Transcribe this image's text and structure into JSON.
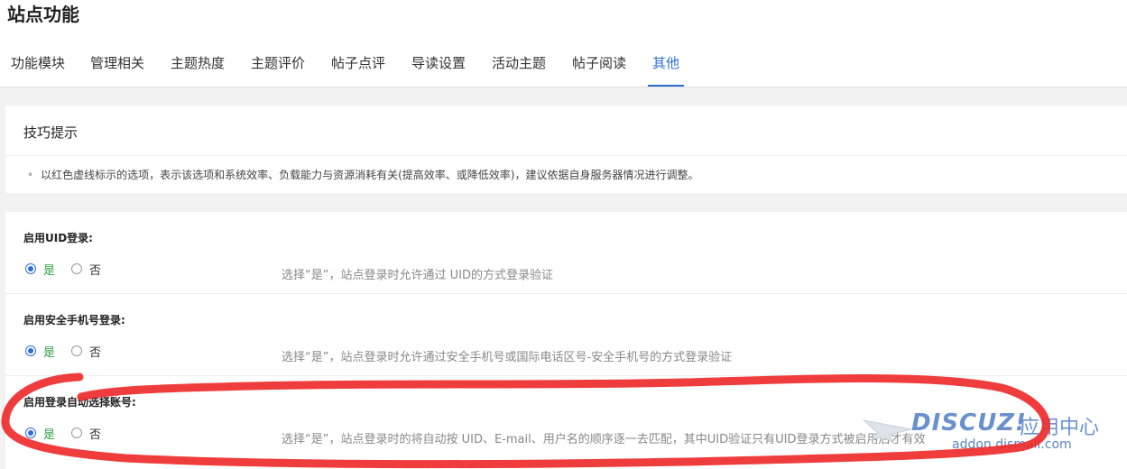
{
  "page": {
    "title": "站点功能"
  },
  "tabs": [
    {
      "label": "功能模块"
    },
    {
      "label": "管理相关"
    },
    {
      "label": "主题热度"
    },
    {
      "label": "主题评价"
    },
    {
      "label": "帖子点评"
    },
    {
      "label": "导读设置"
    },
    {
      "label": "活动主题"
    },
    {
      "label": "帖子阅读"
    },
    {
      "label": "其他",
      "active": true
    }
  ],
  "tips": {
    "title": "技巧提示",
    "bullet": "•",
    "text": "以红色虚线标示的选项，表示该选项和系统效率、负载能力与资源消耗有关(提高效率、或降低效率)，建议依据自身服务器情况进行调整。"
  },
  "settings": [
    {
      "label": "启用UID登录:",
      "yes_label": "是",
      "no_label": "否",
      "selected": "yes",
      "description": "选择“是”，站点登录时允许通过 UID的方式登录验证"
    },
    {
      "label": "启用安全手机号登录:",
      "yes_label": "是",
      "no_label": "否",
      "selected": "yes",
      "description": "选择“是”，站点登录时允许通过安全手机号或国际电话区号-安全手机号的方式登录验证"
    },
    {
      "label": "启用登录自动选择账号:",
      "yes_label": "是",
      "no_label": "否",
      "selected": "yes",
      "description": "选择“是”，站点登录时的将自动按 UID、E-mail、用户名的顺序逐一去匹配，其中UID验证只有UID登录方式被启用后才有效"
    }
  ],
  "watermark": {
    "logo": "DISCUZ!",
    "cn": "应用中心",
    "url": "addon.dismall.com"
  },
  "colors": {
    "accent": "#2d6ed5",
    "yes_green": "#2f9e44",
    "annotation_red": "#ee2b2b"
  }
}
